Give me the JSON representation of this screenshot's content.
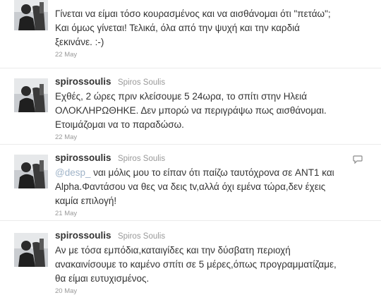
{
  "tweets": [
    {
      "screen_name": "",
      "full_name": "",
      "lines": [
        "Γίνεται να είμαι τόσο κουρασμένος και να αισθάνομαι ότι \"πετάω\";",
        "Και όμως γίνεται! Τελικά, όλα από την ψυχή και την καρδιά",
        "ξεκινάνε. :-)"
      ],
      "timestamp": "22 May"
    },
    {
      "screen_name": "spirossoulis",
      "full_name": "Spiros Soulis",
      "lines": [
        "Εχθές, 2 ώρες πριν κλείσουμε 5 24ωρα, το σπίτι στην Ηλειά",
        "ΟΛΟΚΛΗΡΩΘΗΚΕ. Δεν μπορώ να περιγράψω πως αισθάνομαι.",
        "Ετοιμάζομαι να το παραδώσω."
      ],
      "timestamp": "22 May"
    },
    {
      "screen_name": "spirossoulis",
      "full_name": "Spiros Soulis",
      "mention": "@desp_",
      "first_line_rest": " ναι μόλις μου το είπαν ότι παίζω ταυτόχρονα σε ANT1 και",
      "lines": [
        "Alpha.Φαντάσου να θες να δεις tv,αλλά όχι εμένα τώρα,δεν έχεις",
        "καμία επιλογή!"
      ],
      "timestamp": "21 May",
      "reply_icon": "reply-icon"
    },
    {
      "screen_name": "spirossoulis",
      "full_name": "Spiros Soulis",
      "lines": [
        "Αν με τόσα εμπόδια,καταιγίδες και την δύσβατη περιοχή",
        "ανακαινίσουμε το καμένο σπίτι σε 5 μέρες,όπως προγραμματίζαμε,",
        "θα είμαι ευτυχισμένος."
      ],
      "timestamp": "20 May"
    }
  ],
  "colors": {
    "text": "#333333",
    "muted": "#999999",
    "mention": "#9fb3c8",
    "divider": "#ebebeb"
  }
}
